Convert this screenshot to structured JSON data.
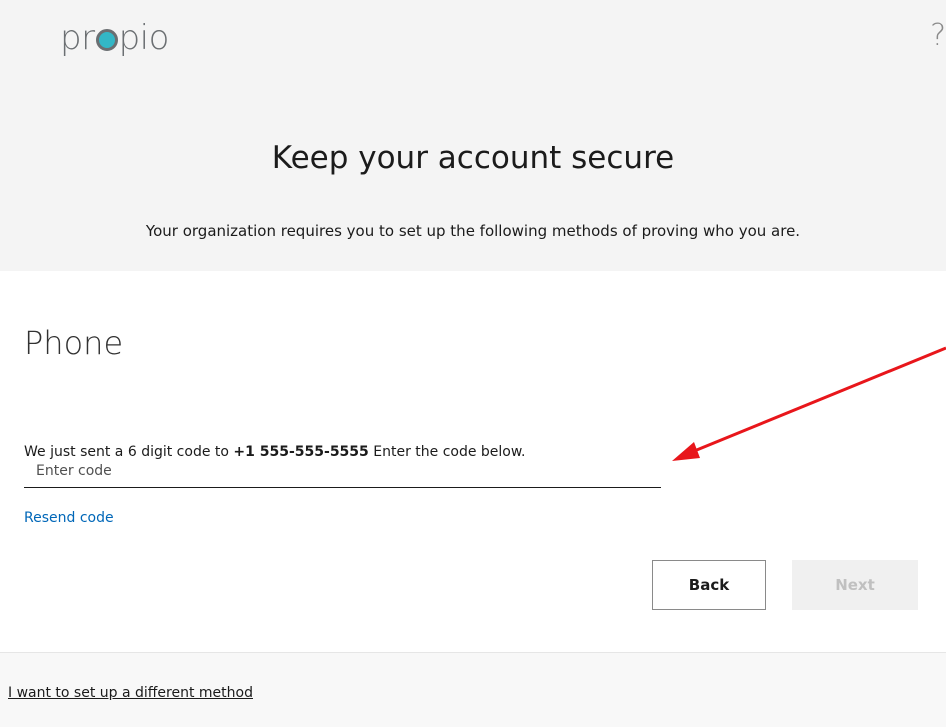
{
  "header": {
    "logo_prefix": "pr",
    "logo_suffix": "pio",
    "help_glyph": "?"
  },
  "title_band": {
    "title": "Keep your account secure",
    "subtitle": "Your organization requires you to set up the following methods of proving who you are."
  },
  "method": {
    "title": "Phone",
    "instruction_prefix": "We just sent a 6 digit code to ",
    "phone_number": "+1 555-555-5555",
    "instruction_suffix": " Enter the code below.",
    "code_input": {
      "value": "",
      "placeholder": "Enter code"
    },
    "resend_label": "Resend code"
  },
  "actions": {
    "back_label": "Back",
    "next_label": "Next"
  },
  "footer": {
    "different_method_label": "I want to set up a different method"
  },
  "colors": {
    "brand_teal": "#33b7c6",
    "link_blue": "#0067b8",
    "annotation_red": "#e8161b",
    "band_gray": "#f4f4f4"
  },
  "icons": {
    "help": "question-mark-icon",
    "annotation": "red-arrow-icon"
  }
}
